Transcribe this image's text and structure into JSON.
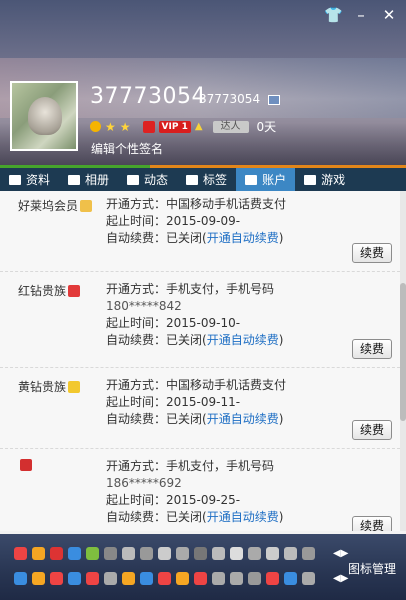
{
  "profile": {
    "nickname": "37773054",
    "qq_number": "37773054",
    "signature": "编辑个性签名",
    "talent_label": "达人",
    "days": "0天",
    "vip_label": "VIP 1"
  },
  "tabs": [
    {
      "label": "资料",
      "icon": "profile-card-icon"
    },
    {
      "label": "相册",
      "icon": "photo-icon"
    },
    {
      "label": "动态",
      "icon": "list-icon"
    },
    {
      "label": "标签",
      "icon": "bookmark-icon"
    },
    {
      "label": "账户",
      "icon": "briefcase-icon",
      "active": true
    },
    {
      "label": "游戏",
      "icon": "game-icon"
    }
  ],
  "items": [
    {
      "name": "好莱坞会员",
      "lines": [
        {
          "label": "开通方式：",
          "value": "中国移动手机话费支付"
        },
        {
          "label": "起止时间：",
          "value": "2015-09-09-"
        },
        {
          "label": "自动续费：",
          "value": "已关闭(",
          "link": "开通自动续费",
          "suffix": ")"
        }
      ],
      "button": "续费"
    },
    {
      "name": "红钻贵族",
      "lines": [
        {
          "label": "开通方式：",
          "value": "手机支付，手机号码"
        },
        {
          "label": "",
          "value": "180*****842"
        },
        {
          "label": "起止时间：",
          "value": "2015-09-10-"
        },
        {
          "label": "自动续费：",
          "value": "已关闭(",
          "link": "开通自动续费",
          "suffix": ")"
        }
      ],
      "button": "续费"
    },
    {
      "name": "黄钻贵族",
      "lines": [
        {
          "label": "开通方式：",
          "value": "中国移动手机话费支付"
        },
        {
          "label": "起止时间：",
          "value": "2015-09-11-"
        },
        {
          "label": "自动续费：",
          "value": "已关闭(",
          "link": "开通自动续费",
          "suffix": ")"
        }
      ],
      "button": "续费"
    },
    {
      "name": "",
      "lines": [
        {
          "label": "开通方式：",
          "value": "手机支付，手机号码"
        },
        {
          "label": "",
          "value": "186*****692"
        },
        {
          "label": "起止时间：",
          "value": "2015-09-25-"
        },
        {
          "label": "自动续费：",
          "value": "已关闭(",
          "link": "开通自动续费",
          "suffix": ")"
        }
      ],
      "button": "续费"
    }
  ],
  "footer": {
    "manage_label": "图标管理",
    "row1_colors": [
      "#e44",
      "#f5a623",
      "#d33",
      "#3a8de0",
      "#7fbf3f",
      "#888",
      "#bbb",
      "#999",
      "#ccc",
      "#aaa",
      "#777",
      "#bbb",
      "#ddd",
      "#aaa",
      "#ccc",
      "#bbb",
      "#999"
    ],
    "row2_colors": [
      "#3a8de0",
      "#f5a623",
      "#e44",
      "#3a8de0",
      "#e44",
      "#aaa",
      "#f5a623",
      "#3a8de0",
      "#e44",
      "#f5a623",
      "#e44",
      "#aaa",
      "#aaa",
      "#999",
      "#e44",
      "#3a8de0",
      "#aaa"
    ]
  },
  "colors": {
    "tab_bg": "#1d3a52",
    "tab_active": "#3c87c4",
    "link": "#1f6fc4",
    "accent_orange": "#e2861a",
    "accent_green": "#46a52c"
  }
}
